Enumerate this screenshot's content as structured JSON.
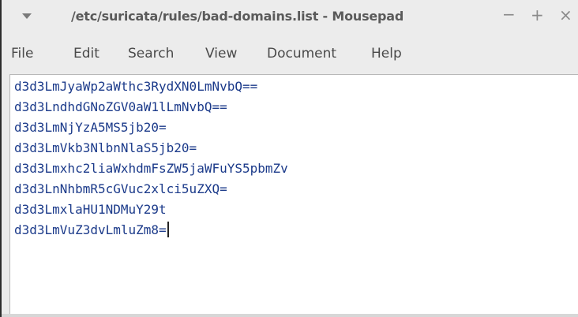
{
  "window": {
    "title": "/etc/suricata/rules/bad-domains.list - Mousepad",
    "minimize": "−",
    "maximize": "+",
    "close": "×"
  },
  "menu": {
    "file": "File",
    "edit": "Edit",
    "search": "Search",
    "view": "View",
    "document": "Document",
    "help": "Help"
  },
  "editor": {
    "lines": [
      "d3d3LmJyaWp2aWthc3RydXN0LmNvbQ==",
      "d3d3LndhdGNoZGV0aW1lLmNvbQ==",
      "d3d3LmNjYzA5MS5jb20=",
      "d3d3LmVkb3NlbnNlaS5jb20=",
      "d3d3Lmxhc2liaWxhdmFsZW5jaWFuYS5pbmZv",
      "d3d3LnNhbmR5cGVuc2xlci5uZXQ=",
      "d3d3LmxlaHU1NDMuY29t",
      "d3d3LmVuZ3dvLmluZm8="
    ]
  },
  "icons": {
    "window_menu": "triangle-down-icon"
  }
}
